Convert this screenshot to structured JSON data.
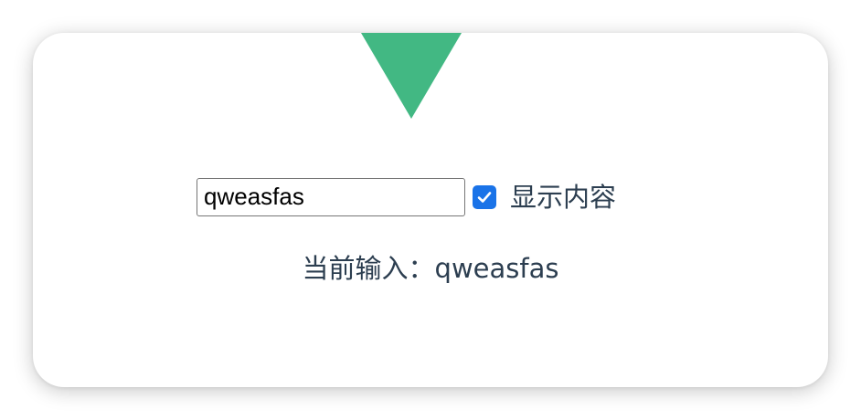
{
  "logo": {
    "icon": "vue-triangle-logo",
    "color": "#42b883"
  },
  "form": {
    "input_value": "qweasfas",
    "checkbox_checked": true,
    "checkbox_label": "显示内容"
  },
  "output": {
    "prefix": "当前输入：",
    "value": "qweasfas"
  }
}
